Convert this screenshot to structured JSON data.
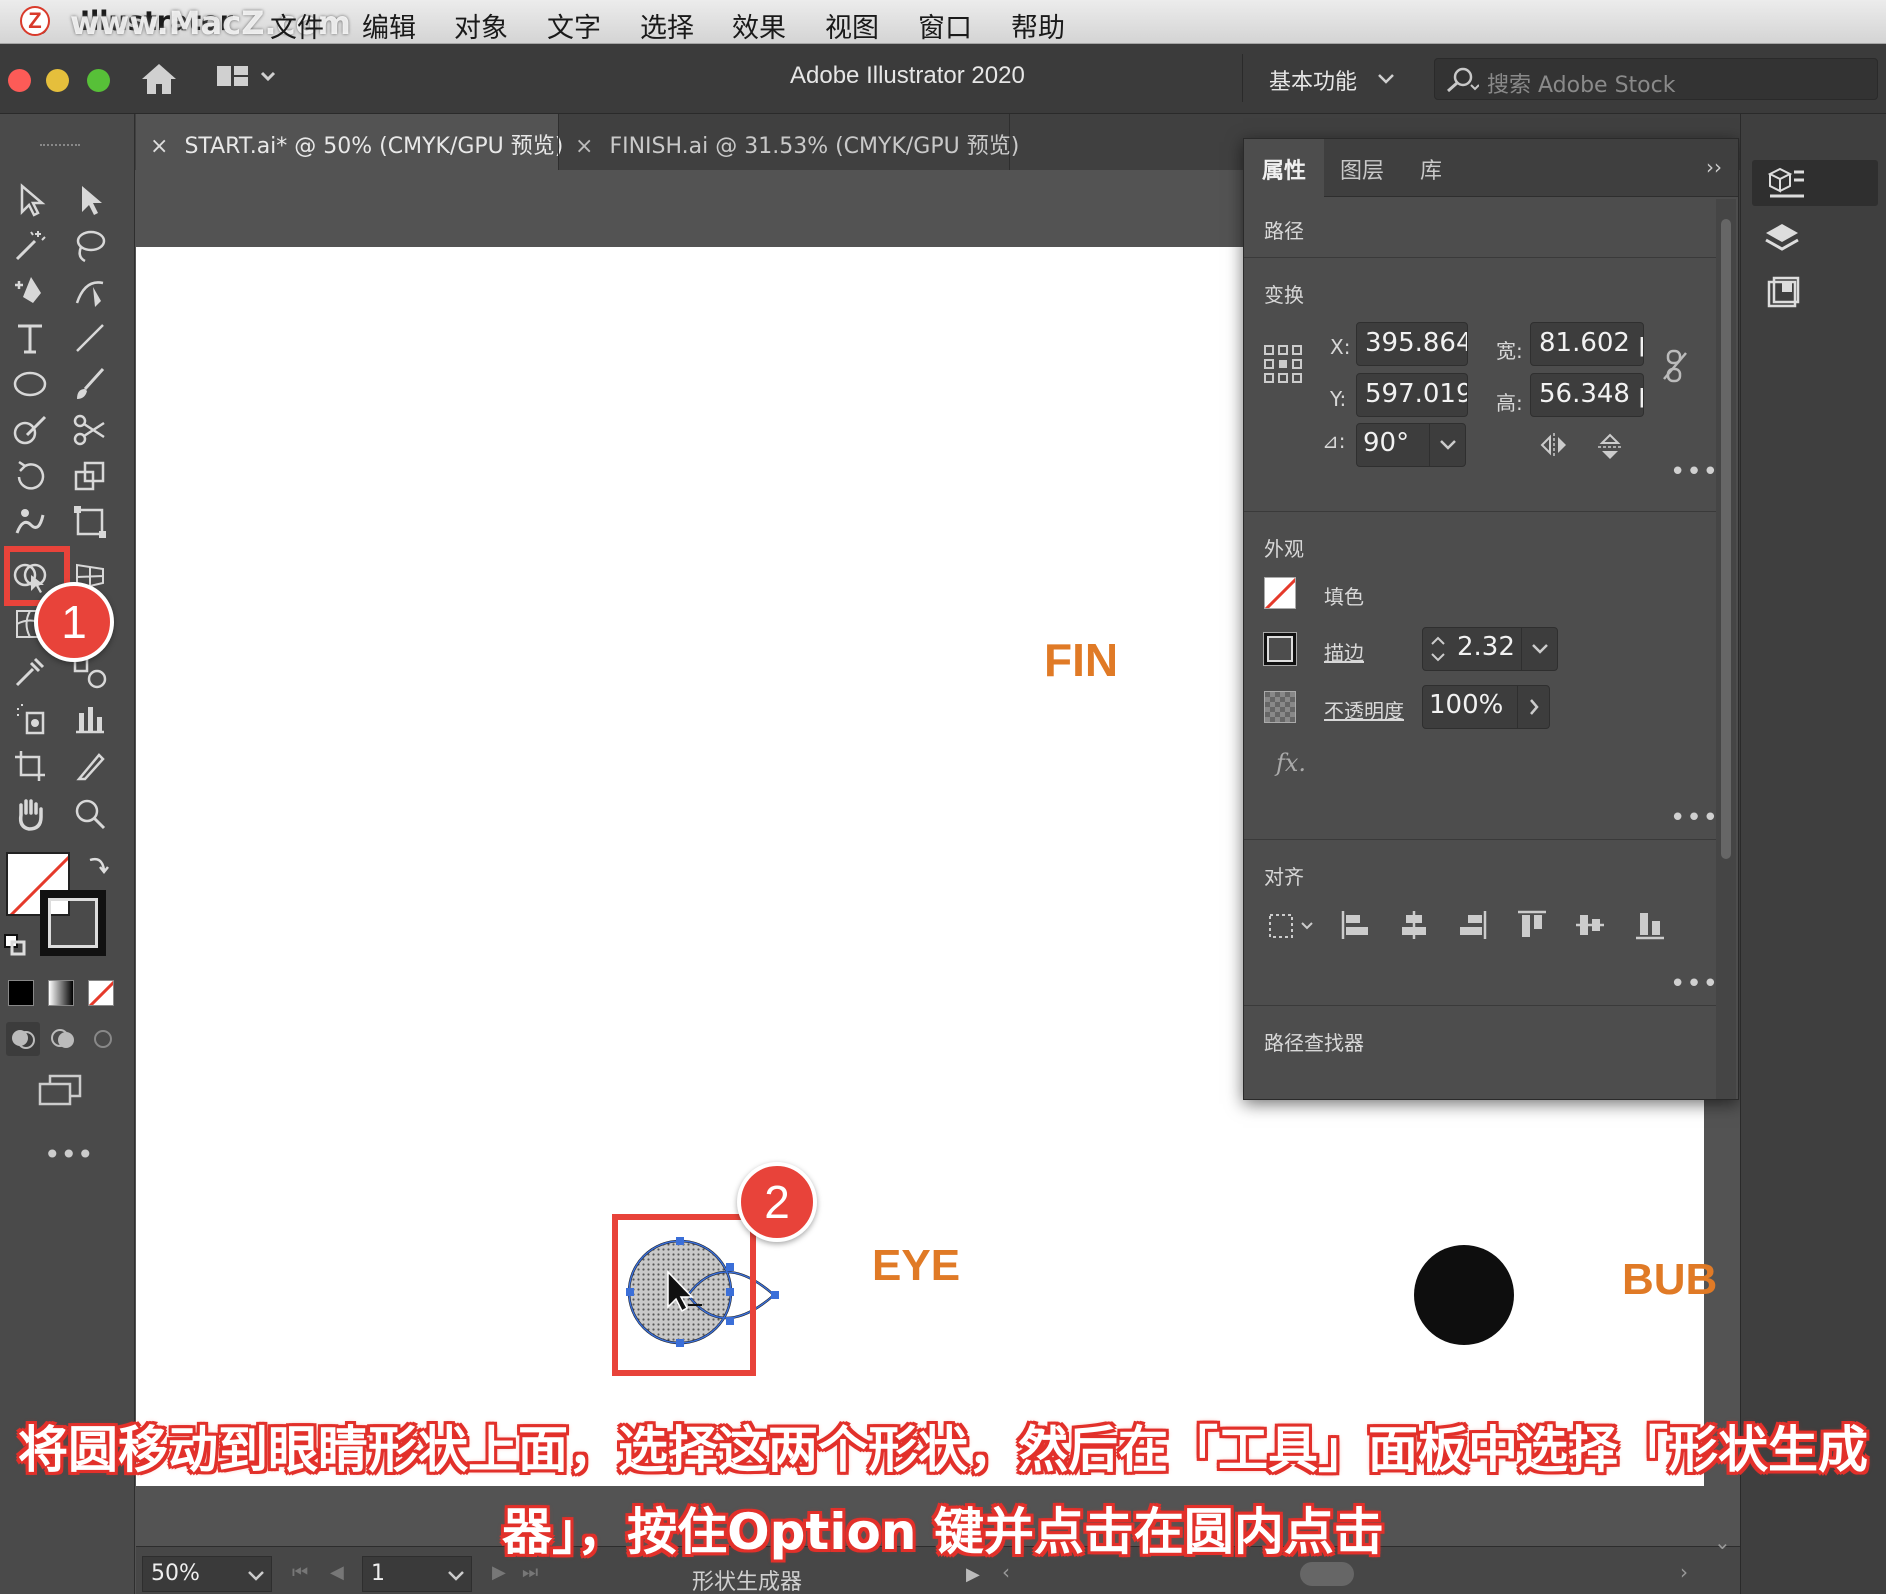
{
  "menubar": {
    "app_name": "Illustrator",
    "watermark": "www.MacZ.com",
    "items": [
      "文件",
      "编辑",
      "对象",
      "文字",
      "选择",
      "效果",
      "视图",
      "窗口",
      "帮助"
    ]
  },
  "titlebar": {
    "title": "Adobe Illustrator 2020",
    "workspace": "基本功能",
    "search_placeholder": "搜索 Adobe Stock"
  },
  "doc_tabs": [
    {
      "label": "START.ai* @ 50% (CMYK/GPU 预览)",
      "active": true
    },
    {
      "label": "FINISH.ai @ 31.53% (CMYK/GPU 预览)",
      "active": false
    }
  ],
  "properties_panel": {
    "tabs": [
      "属性",
      "图层",
      "库"
    ],
    "object_type": "路径",
    "transform": {
      "heading": "变换",
      "x_label": "X:",
      "x": "395.864",
      "y_label": "Y:",
      "y": "597.019",
      "w_label": "宽:",
      "w": "81.602 p",
      "h_label": "高:",
      "h": "56.348 p",
      "angle_symbol": "⊿:",
      "angle": "90°"
    },
    "appearance": {
      "heading": "外观",
      "fill_label": "填色",
      "stroke_label": "描边",
      "stroke_value": "2.32",
      "opacity_label": "不透明度",
      "opacity_value": "100%",
      "fx": "fx."
    },
    "align": {
      "heading": "对齐"
    },
    "pathfinder": {
      "heading": "路径查找器"
    }
  },
  "artboard": {
    "labels": {
      "fin": "FIN",
      "eye": "EYE",
      "bub": "BUB"
    }
  },
  "statusbar": {
    "zoom": "50%",
    "artboard_number": "1",
    "tool_name": "形状生成器"
  },
  "annotations": {
    "badge1": "1",
    "badge2": "2",
    "caption_line1": "将圆移动到眼睛形状上面，选择这两个形状，然后在「工具」面板中选择「形状生成",
    "caption_line2": "器」，按住Option 键并点击在圆内点击"
  },
  "colors": {
    "accent_orange": "#e07a26",
    "annotation_red": "#e8433a",
    "selection_blue": "#3b6fd8"
  },
  "icons": {
    "home": "home-icon",
    "search": "search-icon",
    "layers": "layers-icon",
    "shape_builder": "shape-builder-icon",
    "zoom": "zoom-icon",
    "hand": "hand-icon"
  }
}
